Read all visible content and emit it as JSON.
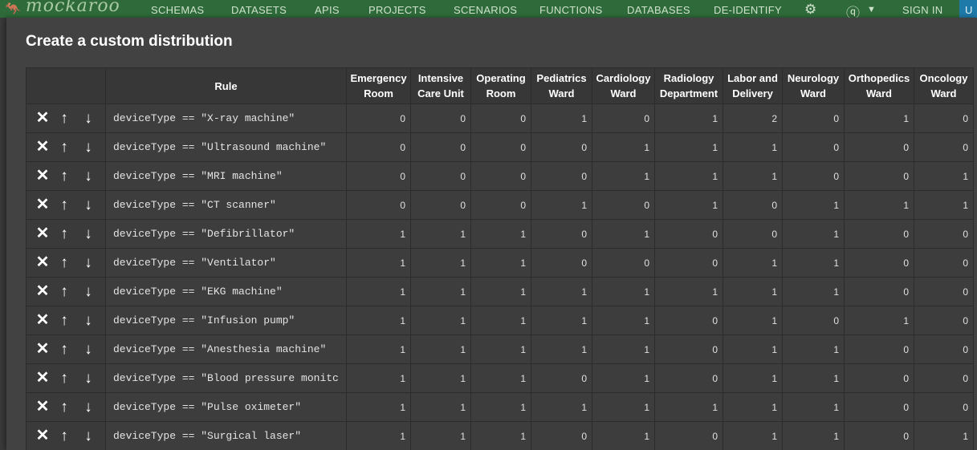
{
  "nav": {
    "brand": "mockaroo",
    "items": [
      "SCHEMAS",
      "DATASETS",
      "APIS",
      "PROJECTS",
      "SCENARIOS",
      "FUNCTIONS",
      "DATABASES",
      "DE-IDENTIFY"
    ],
    "sign_in": "SIGN IN",
    "right_letter": "U"
  },
  "modal": {
    "title": "Create a custom distribution"
  },
  "table": {
    "rule_header": "Rule",
    "columns": [
      [
        "Emergency",
        "Room"
      ],
      [
        "Intensive",
        "Care Unit"
      ],
      [
        "Operating",
        "Room"
      ],
      [
        "Pediatrics",
        "Ward"
      ],
      [
        "Cardiology",
        "Ward"
      ],
      [
        "Radiology",
        "Department"
      ],
      [
        "Labor and",
        "Delivery"
      ],
      [
        "Neurology",
        "Ward"
      ],
      [
        "Orthopedics",
        "Ward"
      ],
      [
        "Oncology",
        "Ward"
      ]
    ],
    "rows": [
      {
        "rule": "deviceType == \"X-ray machine\"",
        "values": [
          "0",
          "0",
          "0",
          "1",
          "0",
          "1",
          "2",
          "0",
          "1",
          "0"
        ]
      },
      {
        "rule": "deviceType == \"Ultrasound machine\"",
        "values": [
          "0",
          "0",
          "0",
          "0",
          "1",
          "1",
          "1",
          "0",
          "0",
          "0"
        ]
      },
      {
        "rule": "deviceType == \"MRI machine\"",
        "values": [
          "0",
          "0",
          "0",
          "0",
          "1",
          "1",
          "1",
          "0",
          "0",
          "1"
        ]
      },
      {
        "rule": "deviceType == \"CT scanner\"",
        "values": [
          "0",
          "0",
          "0",
          "1",
          "0",
          "1",
          "0",
          "1",
          "1",
          "1"
        ]
      },
      {
        "rule": "deviceType == \"Defibrillator\"",
        "values": [
          "1",
          "1",
          "1",
          "0",
          "1",
          "0",
          "0",
          "1",
          "0",
          "0"
        ]
      },
      {
        "rule": "deviceType == \"Ventilator\"",
        "values": [
          "1",
          "1",
          "1",
          "0",
          "0",
          "0",
          "1",
          "1",
          "0",
          "0"
        ]
      },
      {
        "rule": "deviceType == \"EKG machine\"",
        "values": [
          "1",
          "1",
          "1",
          "1",
          "1",
          "1",
          "1",
          "1",
          "0",
          "0"
        ]
      },
      {
        "rule": "deviceType == \"Infusion pump\"",
        "values": [
          "1",
          "1",
          "1",
          "1",
          "1",
          "0",
          "1",
          "0",
          "1",
          "0"
        ]
      },
      {
        "rule": "deviceType == \"Anesthesia machine\"",
        "values": [
          "1",
          "1",
          "1",
          "1",
          "1",
          "0",
          "1",
          "1",
          "0",
          "0"
        ]
      },
      {
        "rule": "deviceType == \"Blood pressure monitc",
        "values": [
          "1",
          "1",
          "1",
          "0",
          "1",
          "0",
          "1",
          "1",
          "0",
          "0"
        ]
      },
      {
        "rule": "deviceType == \"Pulse oximeter\"",
        "values": [
          "1",
          "1",
          "1",
          "1",
          "1",
          "1",
          "1",
          "1",
          "0",
          "0"
        ]
      },
      {
        "rule": "deviceType == \"Surgical laser\"",
        "values": [
          "1",
          "1",
          "1",
          "0",
          "1",
          "0",
          "1",
          "1",
          "0",
          "1"
        ]
      }
    ]
  }
}
